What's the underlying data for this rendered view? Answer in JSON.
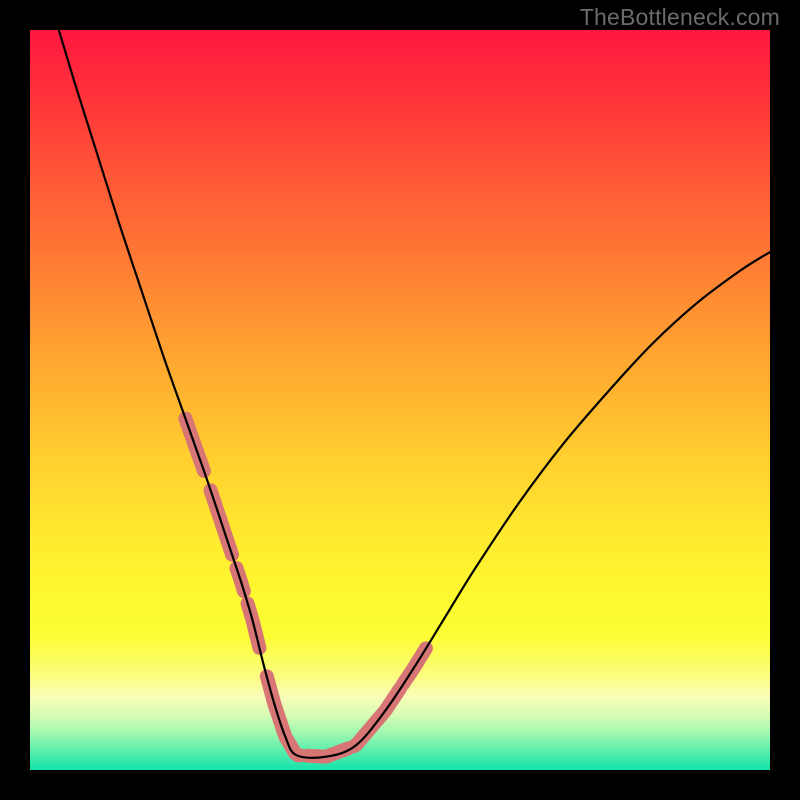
{
  "watermark": "TheBottleneck.com",
  "chart_data": {
    "type": "line",
    "title": "",
    "xlabel": "",
    "ylabel": "",
    "xlim": [
      0,
      100
    ],
    "ylim": [
      0,
      100
    ],
    "x": [
      0,
      3,
      6,
      9,
      12,
      15,
      18,
      21,
      24,
      27,
      28.5,
      30,
      31.5,
      33,
      34.5,
      36,
      40,
      44,
      48,
      52,
      56,
      60,
      66,
      72,
      78,
      84,
      90,
      96,
      100
    ],
    "values": [
      113,
      103,
      93,
      83.5,
      74,
      65,
      56,
      47.5,
      39,
      30,
      25.5,
      20.5,
      14.5,
      9,
      4.5,
      2,
      1.8,
      3.3,
      8,
      14,
      20.5,
      27,
      36,
      44,
      51,
      57.5,
      63,
      67.5,
      70
    ],
    "highlight_segments_x": [
      [
        21,
        23.5
      ],
      [
        24.4,
        27.3
      ],
      [
        27.9,
        28.9
      ],
      [
        29.4,
        31
      ],
      [
        32,
        36.5
      ],
      [
        37.5,
        41
      ],
      [
        41.5,
        43
      ],
      [
        43.8,
        50
      ],
      [
        50.4,
        53.5
      ]
    ],
    "colors": {
      "curve": "#000000",
      "highlight": "#d87676",
      "background_top": "#ff173f",
      "background_bottom": "#14e2ab"
    }
  }
}
